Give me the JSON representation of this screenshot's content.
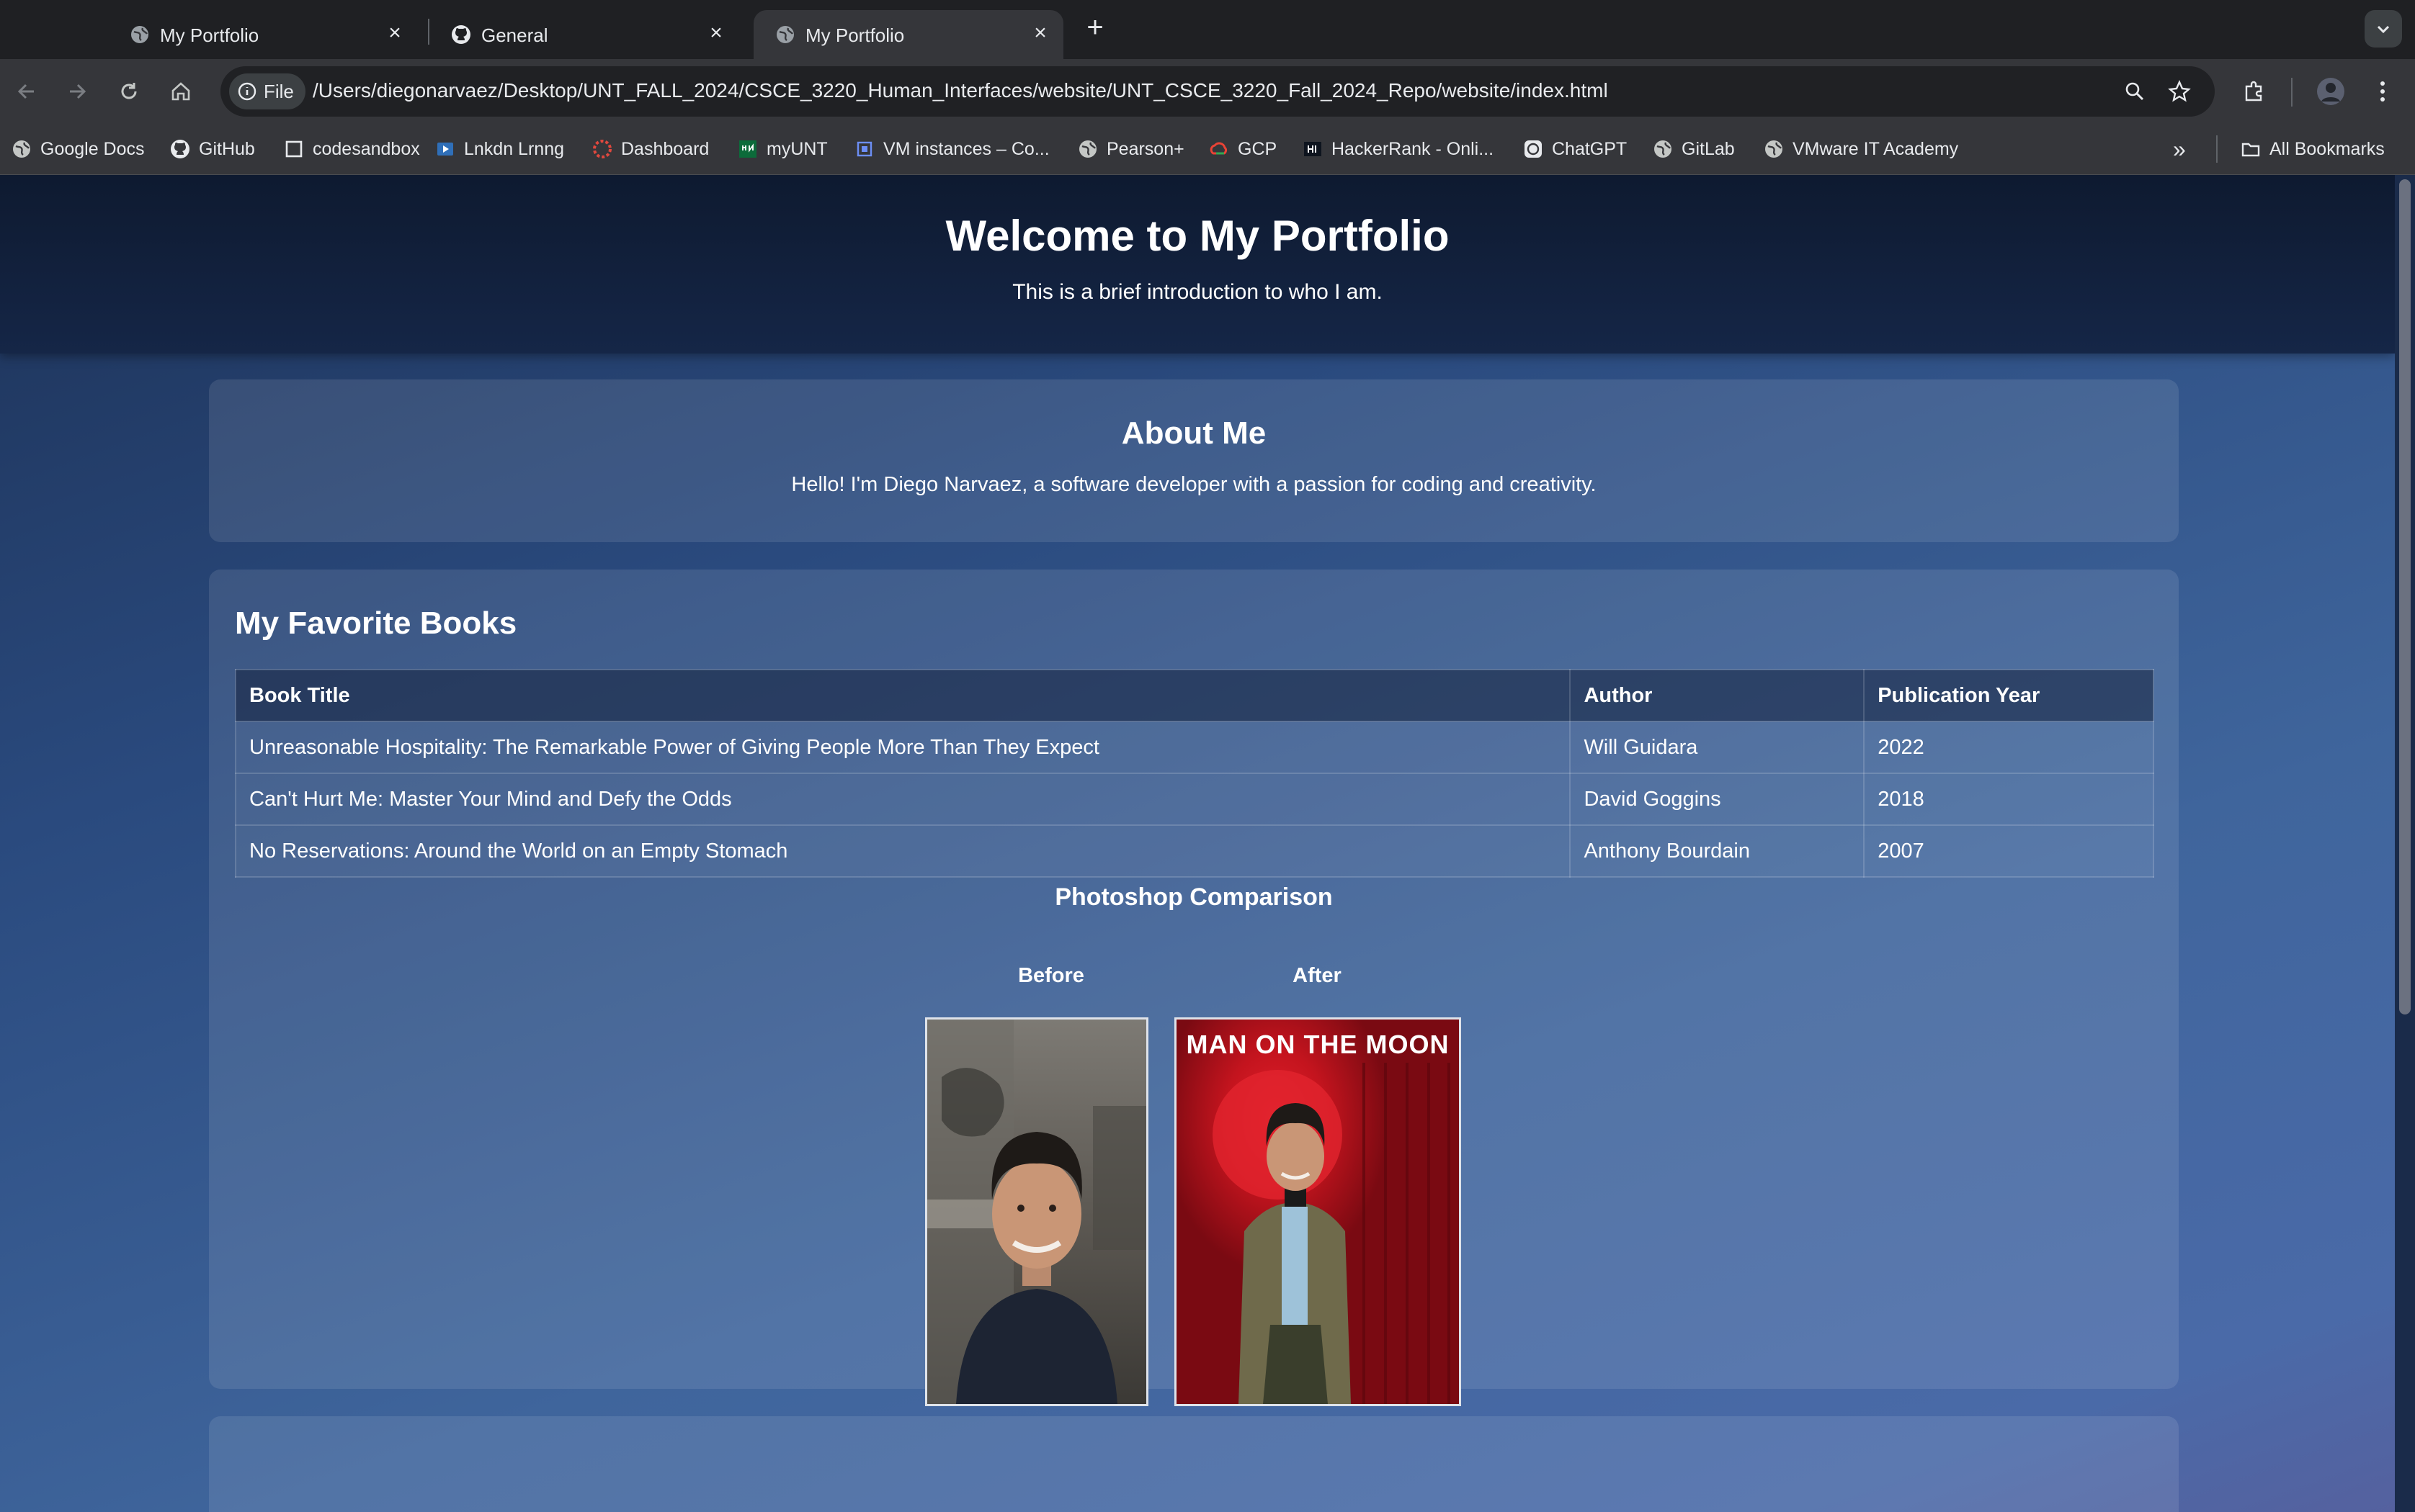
{
  "browser": {
    "tabs": [
      {
        "title": "My Portfolio",
        "icon": "globe-icon",
        "active": false
      },
      {
        "title": "General",
        "icon": "github-icon",
        "active": false
      },
      {
        "title": "My Portfolio",
        "icon": "globe-icon",
        "active": true
      }
    ],
    "address_chip": "File",
    "url": "/Users/diegonarvaez/Desktop/UNT_FALL_2024/CSCE_3220_Human_Interfaces/website/UNT_CSCE_3220_Fall_2024_Repo/website/index.html",
    "bookmarks": [
      {
        "label": "Google Docs",
        "icon": "globe-icon"
      },
      {
        "label": "GitHub",
        "icon": "github-icon"
      },
      {
        "label": "codesandbox",
        "icon": "codesandbox-icon"
      },
      {
        "label": "Lnkdn Lrnng",
        "icon": "linkedin-learning-icon"
      },
      {
        "label": "Dashboard",
        "icon": "dashboard-icon"
      },
      {
        "label": "myUNT",
        "icon": "myunt-icon"
      },
      {
        "label": "VM instances – Co...",
        "icon": "compute-engine-icon"
      },
      {
        "label": "Pearson+",
        "icon": "globe-icon"
      },
      {
        "label": "GCP",
        "icon": "gcp-icon"
      },
      {
        "label": "HackerRank - Onli...",
        "icon": "hackerrank-icon"
      },
      {
        "label": "ChatGPT",
        "icon": "chatgpt-icon"
      },
      {
        "label": "GitLab",
        "icon": "globe-icon"
      },
      {
        "label": "VMware IT Academy",
        "icon": "globe-icon"
      }
    ],
    "overflow_label": "»",
    "all_bookmarks_label": "All Bookmarks"
  },
  "page": {
    "header": {
      "title": "Welcome to My Portfolio",
      "subtitle": "This is a brief introduction to who I am."
    },
    "about": {
      "heading": "About Me",
      "text": "Hello! I'm Diego Narvaez, a software developer with a passion for coding and creativity."
    },
    "books": {
      "heading": "My Favorite Books",
      "columns": [
        "Book Title",
        "Author",
        "Publication Year"
      ],
      "rows": [
        [
          "Unreasonable Hospitality: The Remarkable Power of Giving People More Than They Expect",
          "Will Guidara",
          "2022"
        ],
        [
          "Can't Hurt Me: Master Your Mind and Defy the Odds",
          "David Goggins",
          "2018"
        ],
        [
          "No Reservations: Around the World on an Empty Stomach",
          "Anthony Bourdain",
          "2007"
        ]
      ]
    },
    "comparison": {
      "heading": "Photoshop Comparison",
      "before_label": "Before",
      "after_label": "After",
      "poster_text": "MAN ON THE MOON"
    }
  },
  "colors": {
    "header_bg": "#0e1a30",
    "page_bg": "#2a4a7e",
    "poster_red": "#b3121c"
  }
}
